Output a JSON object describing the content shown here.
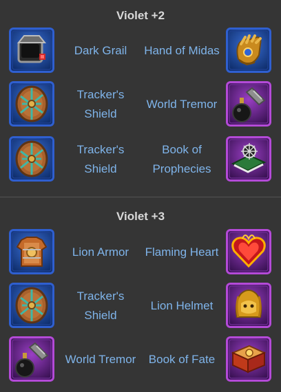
{
  "sections": [
    {
      "title": "Violet +2",
      "rows": [
        {
          "left": {
            "name": "Dark Grail",
            "rarity": "blue",
            "icon": "dark-grail-icon"
          },
          "right": {
            "name": "Hand of Midas",
            "rarity": "blue",
            "icon": "hand-of-midas-icon"
          }
        },
        {
          "left": {
            "name": "Tracker's Shield",
            "rarity": "blue",
            "icon": "trackers-shield-icon"
          },
          "right": {
            "name": "World Tremor",
            "rarity": "violet",
            "icon": "world-tremor-icon"
          }
        },
        {
          "left": {
            "name": "Tracker's Shield",
            "rarity": "blue",
            "icon": "trackers-shield-icon"
          },
          "right": {
            "name": "Book of Prophecies",
            "rarity": "violet",
            "icon": "book-of-prophecies-icon"
          }
        }
      ]
    },
    {
      "title": "Violet +3",
      "rows": [
        {
          "left": {
            "name": "Lion Armor",
            "rarity": "blue",
            "icon": "lion-armor-icon"
          },
          "right": {
            "name": "Flaming Heart",
            "rarity": "violet",
            "icon": "flaming-heart-icon"
          }
        },
        {
          "left": {
            "name": "Tracker's Shield",
            "rarity": "blue",
            "icon": "trackers-shield-icon"
          },
          "right": {
            "name": "Lion Helmet",
            "rarity": "violet",
            "icon": "lion-helmet-icon"
          }
        },
        {
          "left": {
            "name": "World Tremor",
            "rarity": "violet",
            "icon": "world-tremor-icon"
          },
          "right": {
            "name": "Book of Fate",
            "rarity": "violet",
            "icon": "book-of-fate-icon"
          }
        }
      ]
    }
  ],
  "colors": {
    "background": "#353535",
    "label": "#7fb4ea",
    "title": "#d9d9d9",
    "blue_frame": "#2f5fd0",
    "violet_frame": "#b44ad8"
  }
}
